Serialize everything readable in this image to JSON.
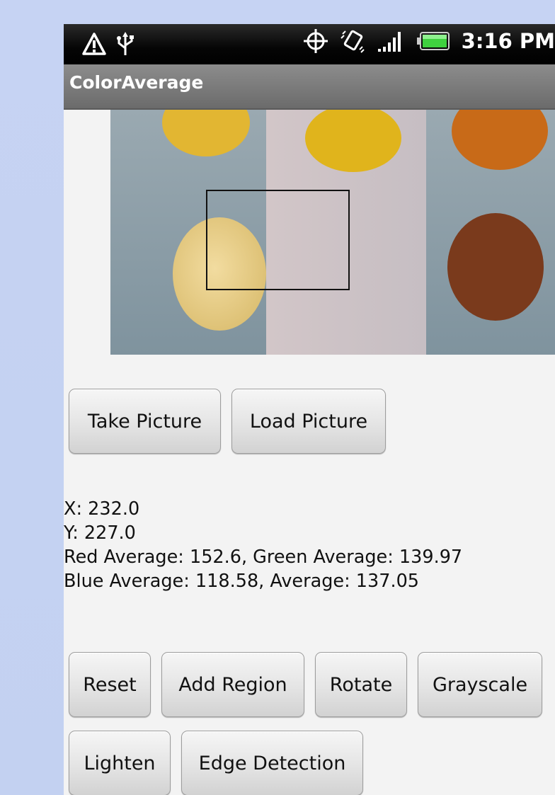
{
  "status_bar": {
    "icons_left": [
      "warning-icon",
      "usb-icon"
    ],
    "icons_right": [
      "gps-icon",
      "vibrate-icon",
      "signal-icon",
      "battery-icon"
    ],
    "time": "3:16 PM"
  },
  "app": {
    "title": "ColorAverage"
  },
  "photo": {
    "description_colors": {
      "wall": "#8a9ba5",
      "paper": "#cfc3c6"
    }
  },
  "picture_buttons": {
    "take": "Take Picture",
    "load": "Load Picture"
  },
  "readout": {
    "x": "X: 232.0",
    "y": "Y: 227.0",
    "rgb_line": "Red Average: 152.6,   Green Average: 139.97",
    "blue_line": "Blue Average: 118.58,   Average: 137.05"
  },
  "actions": {
    "reset": "Reset",
    "add_region": "Add Region",
    "rotate": "Rotate",
    "grayscale": "Grayscale",
    "lighten": "Lighten",
    "edge_detection": "Edge Detection"
  }
}
